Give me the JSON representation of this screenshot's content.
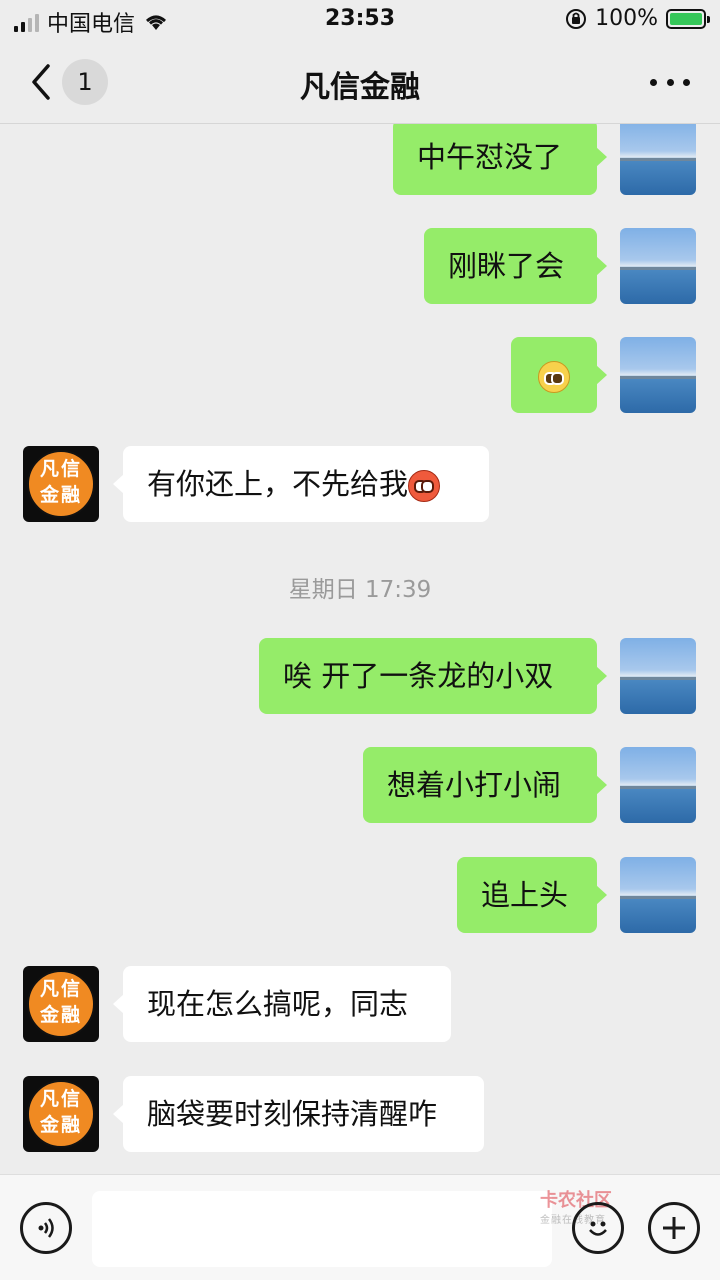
{
  "status_bar": {
    "carrier": "中国电信",
    "time": "23:53",
    "battery_pct": "100%"
  },
  "nav": {
    "unread_count": "1",
    "title": "凡信金融"
  },
  "contact_avatar": {
    "logo_line1": "凡信",
    "logo_line2": "金融"
  },
  "messages": [
    {
      "sender": "me",
      "text": "中午怼没了"
    },
    {
      "sender": "me",
      "text": "刚眯了会"
    },
    {
      "sender": "me",
      "emoji": "pleading-face"
    },
    {
      "sender": "them",
      "text": "有你还上，不先给我",
      "emoji": "flushed-face"
    },
    {
      "timestamp": "星期日 17:39"
    },
    {
      "sender": "me",
      "text": "唉 开了一条龙的小双"
    },
    {
      "sender": "me",
      "text": "想着小打小闹"
    },
    {
      "sender": "me",
      "text": "追上头"
    },
    {
      "sender": "them",
      "text": "现在怎么搞呢，同志"
    },
    {
      "sender": "them",
      "text": "脑袋要时刻保持清醒咋"
    }
  ],
  "input_bar": {
    "placeholder": ""
  },
  "watermark": {
    "line1": "卡农社区",
    "line2": "金融在线教育"
  },
  "colors": {
    "my_bubble": "#95ec69",
    "their_bubble": "#ffffff",
    "background": "#ededed"
  }
}
